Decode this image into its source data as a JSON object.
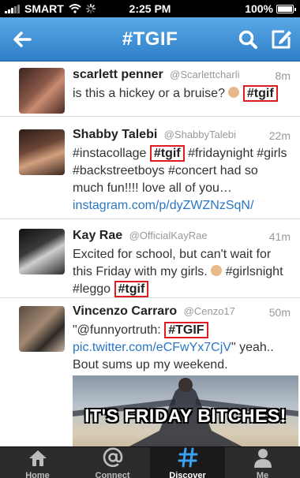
{
  "status_bar": {
    "carrier": "SMART",
    "time": "2:25 PM",
    "battery": "100%"
  },
  "navbar": {
    "title": "#TGIF",
    "back_icon": "back-arrow-icon",
    "search_icon": "search-icon",
    "compose_icon": "compose-icon"
  },
  "tweets": [
    {
      "name": "scarlett penner",
      "handle": "@Scarlettcharli",
      "time": "8m",
      "text_before": "is this a hickey or a bruise? ",
      "hashtag": "#tgif"
    },
    {
      "name": "Shabby Talebi",
      "handle": "@ShabbyTalebi",
      "time": "22m",
      "text_before": "#instacollage ",
      "hashtag": "#tgif",
      "text_after": " #fridaynight #girls #backstreetboys #concert had so much fun!!!! love all of you…",
      "link": "instagram.com/p/dyZWZNzSqN/"
    },
    {
      "name": "Kay Rae",
      "handle": "@OfficialKayRae",
      "time": "41m",
      "text_before": "Excited for school, but can't wait for this Friday with my girls. ",
      "text_mid": " #girlsnight #leggo ",
      "hashtag": "#tgif"
    },
    {
      "name": "Vincenzo Carraro",
      "handle": "@Cenzo17",
      "time": "50m",
      "text_before": "\"@funnyortruth: ",
      "hashtag": "#TGIF",
      "link": "pic.twitter.com/eCFwYx7CjV",
      "text_after": "\" yeah.. Bout sums up my weekend.",
      "photo_caption": "IT'S FRIDAY BITCHES!"
    }
  ],
  "tabbar": [
    {
      "label": "Home",
      "icon": "home-icon",
      "active": false
    },
    {
      "label": "Connect",
      "icon": "at-icon",
      "active": false
    },
    {
      "label": "Discover",
      "icon": "hashtag-icon",
      "active": true
    },
    {
      "label": "Me",
      "icon": "person-icon",
      "active": false
    }
  ]
}
